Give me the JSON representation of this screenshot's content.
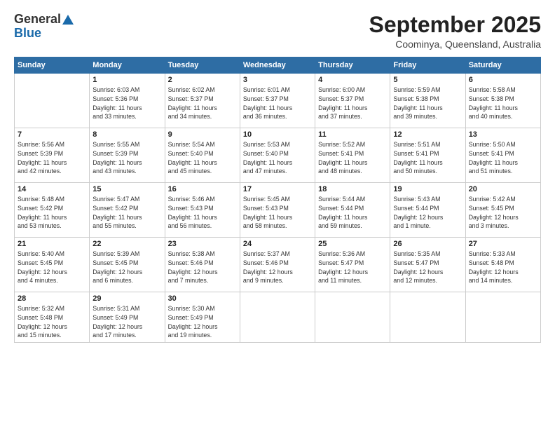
{
  "header": {
    "logo_general": "General",
    "logo_blue": "Blue",
    "title": "September 2025",
    "location": "Coominya, Queensland, Australia"
  },
  "days_of_week": [
    "Sunday",
    "Monday",
    "Tuesday",
    "Wednesday",
    "Thursday",
    "Friday",
    "Saturday"
  ],
  "weeks": [
    [
      {
        "day": "",
        "info": ""
      },
      {
        "day": "1",
        "info": "Sunrise: 6:03 AM\nSunset: 5:36 PM\nDaylight: 11 hours\nand 33 minutes."
      },
      {
        "day": "2",
        "info": "Sunrise: 6:02 AM\nSunset: 5:37 PM\nDaylight: 11 hours\nand 34 minutes."
      },
      {
        "day": "3",
        "info": "Sunrise: 6:01 AM\nSunset: 5:37 PM\nDaylight: 11 hours\nand 36 minutes."
      },
      {
        "day": "4",
        "info": "Sunrise: 6:00 AM\nSunset: 5:37 PM\nDaylight: 11 hours\nand 37 minutes."
      },
      {
        "day": "5",
        "info": "Sunrise: 5:59 AM\nSunset: 5:38 PM\nDaylight: 11 hours\nand 39 minutes."
      },
      {
        "day": "6",
        "info": "Sunrise: 5:58 AM\nSunset: 5:38 PM\nDaylight: 11 hours\nand 40 minutes."
      }
    ],
    [
      {
        "day": "7",
        "info": "Sunrise: 5:56 AM\nSunset: 5:39 PM\nDaylight: 11 hours\nand 42 minutes."
      },
      {
        "day": "8",
        "info": "Sunrise: 5:55 AM\nSunset: 5:39 PM\nDaylight: 11 hours\nand 43 minutes."
      },
      {
        "day": "9",
        "info": "Sunrise: 5:54 AM\nSunset: 5:40 PM\nDaylight: 11 hours\nand 45 minutes."
      },
      {
        "day": "10",
        "info": "Sunrise: 5:53 AM\nSunset: 5:40 PM\nDaylight: 11 hours\nand 47 minutes."
      },
      {
        "day": "11",
        "info": "Sunrise: 5:52 AM\nSunset: 5:41 PM\nDaylight: 11 hours\nand 48 minutes."
      },
      {
        "day": "12",
        "info": "Sunrise: 5:51 AM\nSunset: 5:41 PM\nDaylight: 11 hours\nand 50 minutes."
      },
      {
        "day": "13",
        "info": "Sunrise: 5:50 AM\nSunset: 5:41 PM\nDaylight: 11 hours\nand 51 minutes."
      }
    ],
    [
      {
        "day": "14",
        "info": "Sunrise: 5:48 AM\nSunset: 5:42 PM\nDaylight: 11 hours\nand 53 minutes."
      },
      {
        "day": "15",
        "info": "Sunrise: 5:47 AM\nSunset: 5:42 PM\nDaylight: 11 hours\nand 55 minutes."
      },
      {
        "day": "16",
        "info": "Sunrise: 5:46 AM\nSunset: 5:43 PM\nDaylight: 11 hours\nand 56 minutes."
      },
      {
        "day": "17",
        "info": "Sunrise: 5:45 AM\nSunset: 5:43 PM\nDaylight: 11 hours\nand 58 minutes."
      },
      {
        "day": "18",
        "info": "Sunrise: 5:44 AM\nSunset: 5:44 PM\nDaylight: 11 hours\nand 59 minutes."
      },
      {
        "day": "19",
        "info": "Sunrise: 5:43 AM\nSunset: 5:44 PM\nDaylight: 12 hours\nand 1 minute."
      },
      {
        "day": "20",
        "info": "Sunrise: 5:42 AM\nSunset: 5:45 PM\nDaylight: 12 hours\nand 3 minutes."
      }
    ],
    [
      {
        "day": "21",
        "info": "Sunrise: 5:40 AM\nSunset: 5:45 PM\nDaylight: 12 hours\nand 4 minutes."
      },
      {
        "day": "22",
        "info": "Sunrise: 5:39 AM\nSunset: 5:45 PM\nDaylight: 12 hours\nand 6 minutes."
      },
      {
        "day": "23",
        "info": "Sunrise: 5:38 AM\nSunset: 5:46 PM\nDaylight: 12 hours\nand 7 minutes."
      },
      {
        "day": "24",
        "info": "Sunrise: 5:37 AM\nSunset: 5:46 PM\nDaylight: 12 hours\nand 9 minutes."
      },
      {
        "day": "25",
        "info": "Sunrise: 5:36 AM\nSunset: 5:47 PM\nDaylight: 12 hours\nand 11 minutes."
      },
      {
        "day": "26",
        "info": "Sunrise: 5:35 AM\nSunset: 5:47 PM\nDaylight: 12 hours\nand 12 minutes."
      },
      {
        "day": "27",
        "info": "Sunrise: 5:33 AM\nSunset: 5:48 PM\nDaylight: 12 hours\nand 14 minutes."
      }
    ],
    [
      {
        "day": "28",
        "info": "Sunrise: 5:32 AM\nSunset: 5:48 PM\nDaylight: 12 hours\nand 15 minutes."
      },
      {
        "day": "29",
        "info": "Sunrise: 5:31 AM\nSunset: 5:49 PM\nDaylight: 12 hours\nand 17 minutes."
      },
      {
        "day": "30",
        "info": "Sunrise: 5:30 AM\nSunset: 5:49 PM\nDaylight: 12 hours\nand 19 minutes."
      },
      {
        "day": "",
        "info": ""
      },
      {
        "day": "",
        "info": ""
      },
      {
        "day": "",
        "info": ""
      },
      {
        "day": "",
        "info": ""
      }
    ]
  ]
}
